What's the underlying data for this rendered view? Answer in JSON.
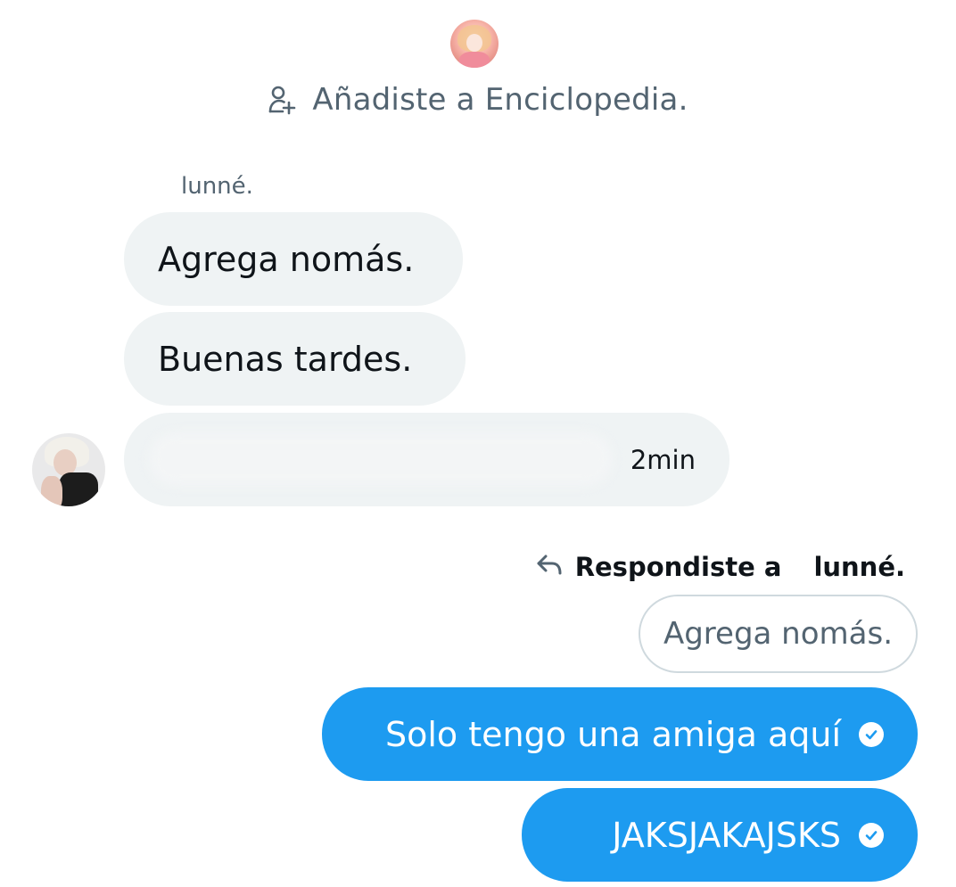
{
  "conversation": {
    "system_message": "Añadiste a Enciclopedia.",
    "system_icon": "person-add-icon",
    "group_avatar": "group-avatar-photo",
    "accent_color": "#1d9bf0",
    "received_bubble_color": "#eff3f4",
    "muted_text_color": "#536471"
  },
  "received": {
    "sender_name": "lunné.",
    "messages": [
      {
        "text": "Agrega nomás."
      },
      {
        "text": "Buenas tardes."
      },
      {
        "text": "",
        "timestamp": "2min"
      }
    ]
  },
  "reply": {
    "icon": "reply-arrow-icon",
    "label": "Respondiste a",
    "target_name": "lunné.",
    "quoted_text": "Agrega nomás."
  },
  "sent": {
    "messages": [
      {
        "text": "Solo tengo una amiga aquí",
        "status_icon": "check-circle-icon"
      },
      {
        "text": "JAKSJAKAJSKS",
        "status_icon": "check-circle-icon"
      }
    ]
  }
}
